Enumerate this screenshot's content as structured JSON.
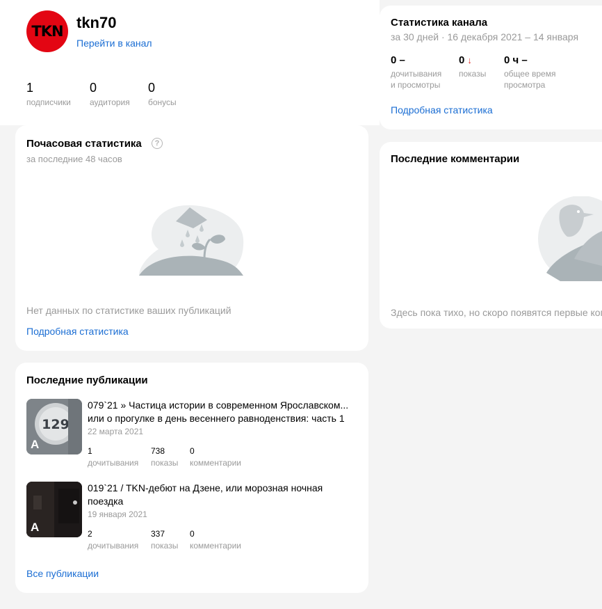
{
  "profile": {
    "avatar_text": "TKN",
    "name": "tkn70",
    "go_to_channel": "Перейти в канал",
    "avatar_color": "#e30613"
  },
  "counters": [
    {
      "value": "1",
      "label": "подписчики"
    },
    {
      "value": "0",
      "label": "аудитория"
    },
    {
      "value": "0",
      "label": "бонусы"
    }
  ],
  "hourly": {
    "title": "Почасовая статистика",
    "help": "?",
    "subtitle": "за последние 48 часов",
    "empty_text": "Нет данных по статистике ваших публикаций",
    "details_link": "Подробная статистика"
  },
  "publications": {
    "title": "Последние публикации",
    "items": [
      {
        "title": "079`21 » Частица истории в современном Ярославском... или о прогулке в день весеннего равноденствия: часть 1",
        "date": "22 марта 2021",
        "badge": "А",
        "metrics": [
          {
            "value": "1",
            "label": "дочитывания"
          },
          {
            "value": "738",
            "label": "показы"
          },
          {
            "value": "0",
            "label": "комментарии"
          }
        ]
      },
      {
        "title": "019`21 / TKN-дебют на Дзене, или морозная ночная поездка",
        "date": "19 января 2021",
        "badge": "А",
        "metrics": [
          {
            "value": "2",
            "label": "дочитывания"
          },
          {
            "value": "337",
            "label": "показы"
          },
          {
            "value": "0",
            "label": "комментарии"
          }
        ]
      }
    ],
    "all_link": "Все публикации"
  },
  "channel_stats": {
    "title": "Статистика канала",
    "subtitle": "за 30 дней · 16 декабря 2021 – 14 января",
    "metrics": [
      {
        "value": "0 –",
        "label": "дочитывания\nи просмотры"
      },
      {
        "value": "0",
        "label": "показы",
        "arrow": "↓"
      },
      {
        "value": "0 ч –",
        "label": "общее время\nпросмотра"
      }
    ],
    "details_link": "Подробная статистика"
  },
  "comments": {
    "title": "Последние комментарии",
    "empty_text": "Здесь пока тихо, но скоро появятся первые комментарии"
  }
}
